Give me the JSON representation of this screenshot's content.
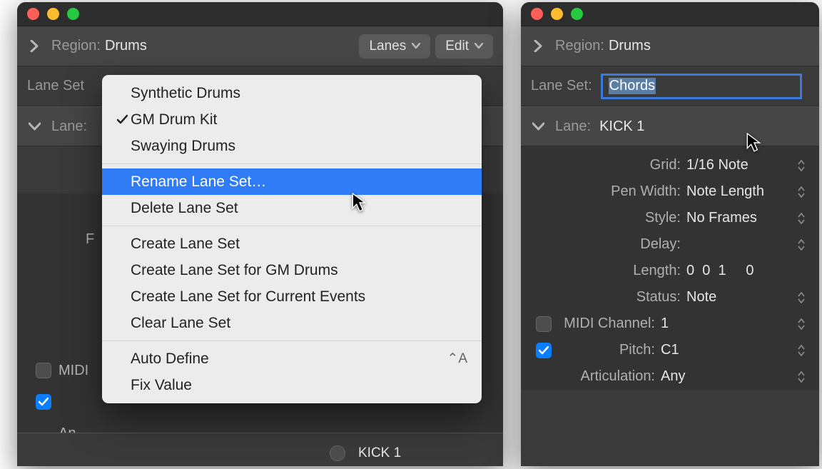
{
  "left": {
    "region_label": "Region:",
    "region_value": "Drums",
    "btn_lanes": "Lanes",
    "btn_edit": "Edit",
    "lane_set_label": "Lane Set",
    "lane_row_label": "Lane:",
    "midi_label": "MIDI",
    "an_label": "An",
    "kick_label": "KICK 1",
    "menu": {
      "items": [
        {
          "label": "Synthetic Drums",
          "checked": false
        },
        {
          "label": "GM Drum Kit",
          "checked": true
        },
        {
          "label": "Swaying Drums",
          "checked": false
        }
      ],
      "group2": [
        {
          "label": "Rename Lane Set…",
          "highlighted": true
        },
        {
          "label": "Delete Lane Set"
        }
      ],
      "group3": [
        {
          "label": "Create Lane Set"
        },
        {
          "label": "Create Lane Set for GM Drums"
        },
        {
          "label": "Create Lane Set for Current Events"
        },
        {
          "label": "Clear Lane Set"
        }
      ],
      "group4": [
        {
          "label": "Auto Define",
          "shortcut": "⌃A"
        },
        {
          "label": "Fix Value"
        }
      ]
    }
  },
  "right": {
    "region_label": "Region:",
    "region_value": "Drums",
    "lane_set_label": "Lane Set:",
    "lane_set_value": "Chords",
    "lane_label": "Lane:",
    "lane_value": "KICK 1",
    "props": {
      "grid_k": "Grid:",
      "grid_v": "1/16 Note",
      "penw_k": "Pen Width:",
      "penw_v": "Note Length",
      "style_k": "Style:",
      "style_v": "No Frames",
      "delay_k": "Delay:",
      "delay_v": "",
      "len_k": "Length:",
      "len_v": "0  0  1     0",
      "status_k": "Status:",
      "status_v": "Note",
      "midi_k": "MIDI Channel:",
      "midi_v": "1",
      "pitch_k": "Pitch:",
      "pitch_v": "C1",
      "artic_k": "Articulation:",
      "artic_v": "Any"
    }
  }
}
